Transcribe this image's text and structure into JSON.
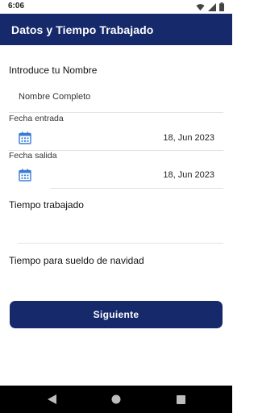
{
  "status_bar": {
    "time": "6:06",
    "icons": [
      "wifi-icon",
      "signal-icon",
      "battery-icon"
    ]
  },
  "app_bar": {
    "title": "Datos y Tiempo Trabajado",
    "background_color": "#16296b"
  },
  "form": {
    "name_heading": "Introduce tu Nombre",
    "name_placeholder": "Nombre Completo",
    "entry_label": "Fecha entrada",
    "entry_date": "18, Jun 2023",
    "exit_label": "Fecha salida",
    "exit_date": "18, Jun 2023",
    "worked_time_heading": "Tiempo trabajado",
    "worked_time_value": "",
    "christmas_heading": "Tiempo para sueldo de navidad"
  },
  "actions": {
    "next_label": "Siguiente",
    "button_color": "#16296b"
  },
  "nav_bar": {
    "icons": [
      "back-icon",
      "home-icon",
      "recents-icon"
    ]
  }
}
